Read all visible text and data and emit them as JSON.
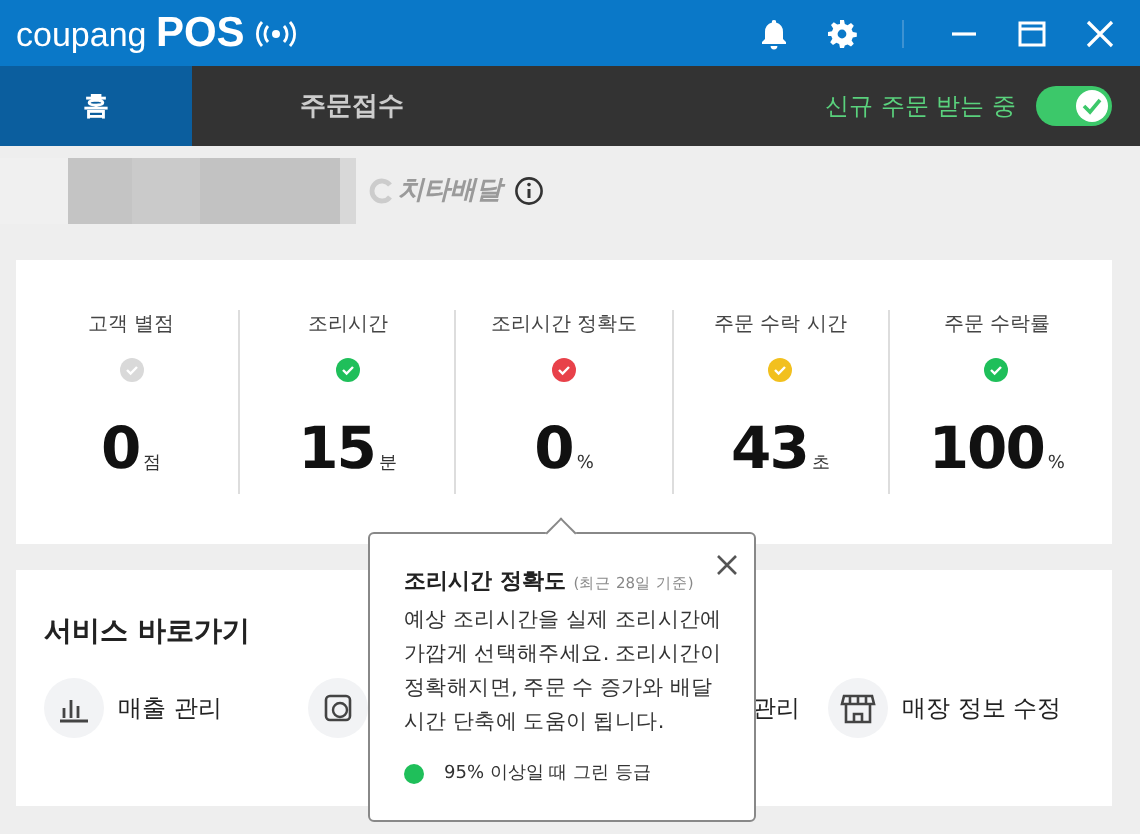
{
  "window": {
    "brand": "coupang",
    "product": "POS"
  },
  "tabs": [
    {
      "label": "홈",
      "selected": true
    },
    {
      "label": "주문접수",
      "selected": false
    }
  ],
  "order_toggle": {
    "label": "신규 주문 받는 중",
    "on": true
  },
  "store": {
    "badge": "치타배달"
  },
  "stats": [
    {
      "label": "고객 별점",
      "color": "#d9d9d9",
      "value": "0",
      "unit": "점"
    },
    {
      "label": "조리시간",
      "color": "#1fbf5a",
      "value": "15",
      "unit": "분"
    },
    {
      "label": "조리시간 정확도",
      "color": "#e8414a",
      "value": "0",
      "unit": "%"
    },
    {
      "label": "주문 수락 시간",
      "color": "#f2c01e",
      "value": "43",
      "unit": "초"
    },
    {
      "label": "주문 수락률",
      "color": "#1fbf5a",
      "value": "100",
      "unit": "%"
    }
  ],
  "shortcuts": {
    "title": "서비스 바로가기",
    "items": [
      {
        "kind": "chart",
        "label": "매출 관리"
      },
      {
        "kind": "coupon"
      },
      {
        "kind": "hidden",
        "label": "관리"
      },
      {
        "kind": "store",
        "label": "매장 정보 수정"
      }
    ]
  },
  "popup": {
    "title": "조리시간 정확도",
    "note": "(최근 28일 기준)",
    "body": "예상 조리시간을 실제 조리시간에 가깝게 선택해주세요. 조리시간이 정확해지면, 주문 수 증가와 배달 시간 단축에 도움이 됩니다.",
    "legend": "95% 이상일 때 그린 등급"
  }
}
